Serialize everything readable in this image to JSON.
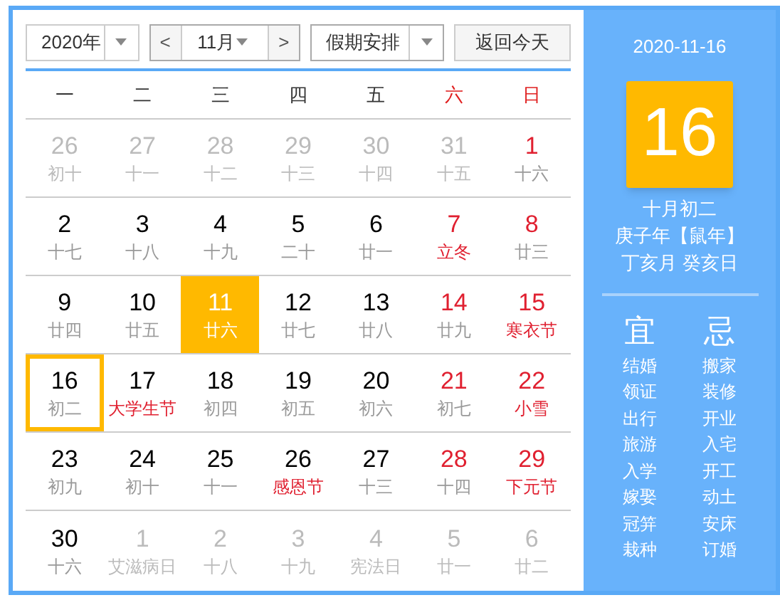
{
  "toolbar": {
    "year": "2020年",
    "month": "11月",
    "prev": "<",
    "next": ">",
    "holiday": "假期安排",
    "today_button": "返回今天"
  },
  "weekdays": [
    {
      "label": "一",
      "weekend": false
    },
    {
      "label": "二",
      "weekend": false
    },
    {
      "label": "三",
      "weekend": false
    },
    {
      "label": "四",
      "weekend": false
    },
    {
      "label": "五",
      "weekend": false
    },
    {
      "label": "六",
      "weekend": true
    },
    {
      "label": "日",
      "weekend": true
    }
  ],
  "weeks": [
    [
      {
        "day": "26",
        "lunar": "初十",
        "other_month": true,
        "selected": false,
        "today": false
      },
      {
        "day": "27",
        "lunar": "十一",
        "other_month": true,
        "selected": false,
        "today": false
      },
      {
        "day": "28",
        "lunar": "十二",
        "other_month": true,
        "selected": false,
        "today": false
      },
      {
        "day": "29",
        "lunar": "十三",
        "other_month": true,
        "selected": false,
        "today": false
      },
      {
        "day": "30",
        "lunar": "十四",
        "other_month": true,
        "selected": false,
        "today": false
      },
      {
        "day": "31",
        "lunar": "十五",
        "other_month": true,
        "selected": false,
        "today": false
      },
      {
        "day": "1",
        "lunar": "十六",
        "other_month": false,
        "weekend": true,
        "festival": false,
        "selected": false,
        "today": false
      }
    ],
    [
      {
        "day": "2",
        "lunar": "十七",
        "other_month": false,
        "weekend": false,
        "festival": false,
        "selected": false,
        "today": false
      },
      {
        "day": "3",
        "lunar": "十八",
        "other_month": false,
        "weekend": false,
        "festival": false,
        "selected": false,
        "today": false
      },
      {
        "day": "4",
        "lunar": "十九",
        "other_month": false,
        "weekend": false,
        "festival": false,
        "selected": false,
        "today": false
      },
      {
        "day": "5",
        "lunar": "二十",
        "other_month": false,
        "weekend": false,
        "festival": false,
        "selected": false,
        "today": false
      },
      {
        "day": "6",
        "lunar": "廿一",
        "other_month": false,
        "weekend": false,
        "festival": false,
        "selected": false,
        "today": false
      },
      {
        "day": "7",
        "lunar": "立冬",
        "other_month": false,
        "weekend": true,
        "festival": true,
        "selected": false,
        "today": false
      },
      {
        "day": "8",
        "lunar": "廿三",
        "other_month": false,
        "weekend": true,
        "festival": false,
        "selected": false,
        "today": false
      }
    ],
    [
      {
        "day": "9",
        "lunar": "廿四",
        "other_month": false,
        "weekend": false,
        "festival": false,
        "selected": false,
        "today": false
      },
      {
        "day": "10",
        "lunar": "廿五",
        "other_month": false,
        "weekend": false,
        "festival": false,
        "selected": false,
        "today": false
      },
      {
        "day": "11",
        "lunar": "廿六",
        "other_month": false,
        "weekend": false,
        "festival": false,
        "selected": true,
        "today": false
      },
      {
        "day": "12",
        "lunar": "廿七",
        "other_month": false,
        "weekend": false,
        "festival": false,
        "selected": false,
        "today": false
      },
      {
        "day": "13",
        "lunar": "廿八",
        "other_month": false,
        "weekend": false,
        "festival": false,
        "selected": false,
        "today": false
      },
      {
        "day": "14",
        "lunar": "廿九",
        "other_month": false,
        "weekend": true,
        "festival": false,
        "selected": false,
        "today": false
      },
      {
        "day": "15",
        "lunar": "寒衣节",
        "other_month": false,
        "weekend": true,
        "festival": true,
        "selected": false,
        "today": false
      }
    ],
    [
      {
        "day": "16",
        "lunar": "初二",
        "other_month": false,
        "weekend": false,
        "festival": false,
        "selected": false,
        "today": true
      },
      {
        "day": "17",
        "lunar": "大学生节",
        "other_month": false,
        "weekend": false,
        "festival": true,
        "selected": false,
        "today": false
      },
      {
        "day": "18",
        "lunar": "初四",
        "other_month": false,
        "weekend": false,
        "festival": false,
        "selected": false,
        "today": false
      },
      {
        "day": "19",
        "lunar": "初五",
        "other_month": false,
        "weekend": false,
        "festival": false,
        "selected": false,
        "today": false
      },
      {
        "day": "20",
        "lunar": "初六",
        "other_month": false,
        "weekend": false,
        "festival": false,
        "selected": false,
        "today": false
      },
      {
        "day": "21",
        "lunar": "初七",
        "other_month": false,
        "weekend": true,
        "festival": false,
        "selected": false,
        "today": false
      },
      {
        "day": "22",
        "lunar": "小雪",
        "other_month": false,
        "weekend": true,
        "festival": true,
        "selected": false,
        "today": false
      }
    ],
    [
      {
        "day": "23",
        "lunar": "初九",
        "other_month": false,
        "weekend": false,
        "festival": false,
        "selected": false,
        "today": false
      },
      {
        "day": "24",
        "lunar": "初十",
        "other_month": false,
        "weekend": false,
        "festival": false,
        "selected": false,
        "today": false
      },
      {
        "day": "25",
        "lunar": "十一",
        "other_month": false,
        "weekend": false,
        "festival": false,
        "selected": false,
        "today": false
      },
      {
        "day": "26",
        "lunar": "感恩节",
        "other_month": false,
        "weekend": false,
        "festival": true,
        "selected": false,
        "today": false
      },
      {
        "day": "27",
        "lunar": "十三",
        "other_month": false,
        "weekend": false,
        "festival": false,
        "selected": false,
        "today": false
      },
      {
        "day": "28",
        "lunar": "十四",
        "other_month": false,
        "weekend": true,
        "festival": false,
        "selected": false,
        "today": false
      },
      {
        "day": "29",
        "lunar": "下元节",
        "other_month": false,
        "weekend": true,
        "festival": true,
        "selected": false,
        "today": false
      }
    ],
    [
      {
        "day": "30",
        "lunar": "十六",
        "other_month": false,
        "weekend": false,
        "festival": false,
        "selected": false,
        "today": false
      },
      {
        "day": "1",
        "lunar": "艾滋病日",
        "other_month": true,
        "selected": false,
        "today": false
      },
      {
        "day": "2",
        "lunar": "十八",
        "other_month": true,
        "selected": false,
        "today": false
      },
      {
        "day": "3",
        "lunar": "十九",
        "other_month": true,
        "selected": false,
        "today": false
      },
      {
        "day": "4",
        "lunar": "宪法日",
        "other_month": true,
        "selected": false,
        "today": false
      },
      {
        "day": "5",
        "lunar": "廿一",
        "other_month": true,
        "selected": false,
        "today": false
      },
      {
        "day": "6",
        "lunar": "廿二",
        "other_month": true,
        "selected": false,
        "today": false
      }
    ]
  ],
  "detail": {
    "date": "2020-11-16",
    "day": "16",
    "lunar_date": "十月初二",
    "year_text": "庚子年【鼠年】",
    "month_day_text": "丁亥月 癸亥日",
    "good_title": "宜",
    "bad_title": "忌",
    "good": [
      "结婚",
      "领证",
      "出行",
      "旅游",
      "入学",
      "嫁娶",
      "冠笄",
      "栽种"
    ],
    "bad": [
      "搬家",
      "装修",
      "开业",
      "入宅",
      "开工",
      "动土",
      "安床",
      "订婚"
    ]
  }
}
